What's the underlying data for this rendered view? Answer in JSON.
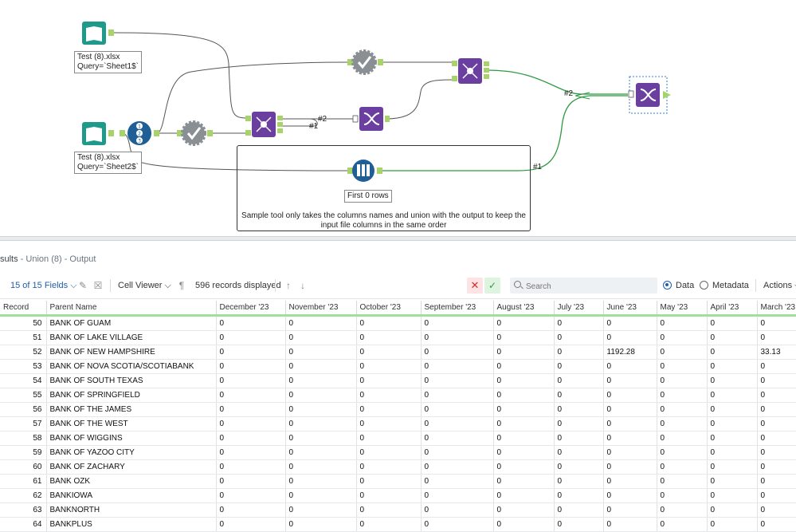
{
  "canvas": {
    "input1": {
      "line1": "Test (8).xlsx",
      "line2": "Query=`Sheet1$`"
    },
    "input2": {
      "line1": "Test (8).xlsx",
      "line2": "Query=`Sheet2$`"
    },
    "sample_label": "First 0 rows",
    "comment": "Sample tool only takes the columns names and union with the output to keep the input file columns in the same order",
    "conn_labels": [
      "#2",
      "#1",
      "#2",
      "#1"
    ],
    "accent_green": "#2e9a42",
    "tool_purple": "#6b3fa0",
    "tool_teal": "#1e9a8a",
    "tool_blue": "#1f5f96"
  },
  "results": {
    "title_prefix": "sults",
    "title_rest": " - Union (8) - Output",
    "toolbar": {
      "fields": "15 of 15 Fields",
      "cell_viewer": "Cell Viewer",
      "records": "596 records displayed",
      "search_placeholder": "Search",
      "data_label": "Data",
      "metadata_label": "Metadata",
      "actions_label": "Actions"
    },
    "columns": [
      "Record",
      "Parent Name",
      "December '23",
      "November '23",
      "October '23",
      "September '23",
      "August '23",
      "July '23",
      "June '23",
      "May '23",
      "April '23",
      "March '23"
    ],
    "rows": [
      [
        "50",
        "BANK OF GUAM",
        "0",
        "0",
        "0",
        "0",
        "0",
        "0",
        "0",
        "0",
        "0",
        "0"
      ],
      [
        "51",
        "BANK OF LAKE VILLAGE",
        "0",
        "0",
        "0",
        "0",
        "0",
        "0",
        "0",
        "0",
        "0",
        "0"
      ],
      [
        "52",
        "BANK OF NEW HAMPSHIRE",
        "0",
        "0",
        "0",
        "0",
        "0",
        "0",
        "1192.28",
        "0",
        "0",
        "33.13"
      ],
      [
        "53",
        "BANK OF NOVA SCOTIA/SCOTIABANK",
        "0",
        "0",
        "0",
        "0",
        "0",
        "0",
        "0",
        "0",
        "0",
        "0"
      ],
      [
        "54",
        "BANK OF SOUTH TEXAS",
        "0",
        "0",
        "0",
        "0",
        "0",
        "0",
        "0",
        "0",
        "0",
        "0"
      ],
      [
        "55",
        "BANK OF SPRINGFIELD",
        "0",
        "0",
        "0",
        "0",
        "0",
        "0",
        "0",
        "0",
        "0",
        "0"
      ],
      [
        "56",
        "BANK OF THE JAMES",
        "0",
        "0",
        "0",
        "0",
        "0",
        "0",
        "0",
        "0",
        "0",
        "0"
      ],
      [
        "57",
        "BANK OF THE WEST",
        "0",
        "0",
        "0",
        "0",
        "0",
        "0",
        "0",
        "0",
        "0",
        "0"
      ],
      [
        "58",
        "BANK OF WIGGINS",
        "0",
        "0",
        "0",
        "0",
        "0",
        "0",
        "0",
        "0",
        "0",
        "0"
      ],
      [
        "59",
        "BANK OF YAZOO CITY",
        "0",
        "0",
        "0",
        "0",
        "0",
        "0",
        "0",
        "0",
        "0",
        "0"
      ],
      [
        "60",
        "BANK OF ZACHARY",
        "0",
        "0",
        "0",
        "0",
        "0",
        "0",
        "0",
        "0",
        "0",
        "0"
      ],
      [
        "61",
        "BANK OZK",
        "0",
        "0",
        "0",
        "0",
        "0",
        "0",
        "0",
        "0",
        "0",
        "0"
      ],
      [
        "62",
        "BANKIOWA",
        "0",
        "0",
        "0",
        "0",
        "0",
        "0",
        "0",
        "0",
        "0",
        "0"
      ],
      [
        "63",
        "BANKNORTH",
        "0",
        "0",
        "0",
        "0",
        "0",
        "0",
        "0",
        "0",
        "0",
        "0"
      ],
      [
        "64",
        "BANKPLUS",
        "0",
        "0",
        "0",
        "0",
        "0",
        "0",
        "0",
        "0",
        "0",
        "0"
      ]
    ]
  }
}
